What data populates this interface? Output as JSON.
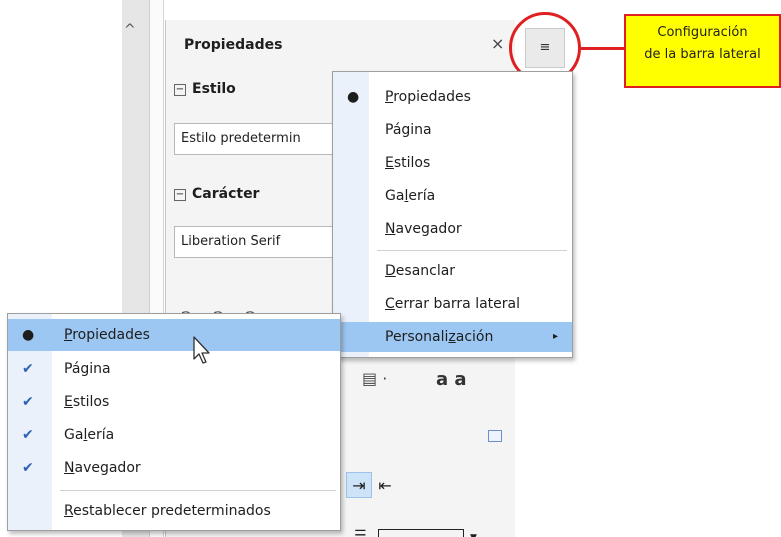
{
  "sidebar": {
    "title": "Propiedades",
    "close_glyph": "×",
    "sections": {
      "estilo": {
        "label": "Estilo",
        "combo_value": "Estilo predetermin"
      },
      "caracter": {
        "label": "Carácter",
        "combo_value": "Liberation Serif"
      }
    },
    "expander_glyph": "−"
  },
  "tab_button": {
    "icon": "sidebar-menu-icon",
    "glyph": "≡"
  },
  "callout": {
    "line1": "Configuración",
    "line2": "de la barra lateral",
    "color": "#ffff00",
    "border": "#e02020"
  },
  "menu_right": {
    "items": [
      {
        "label": "Propiedades",
        "ul": "P",
        "rest": "ropiedades",
        "mark": "●"
      },
      {
        "label": "Página",
        "ul": "",
        "rest": "Página",
        "mark": ""
      },
      {
        "label": "Estilos",
        "ul": "E",
        "rest": "stilos",
        "mark": ""
      },
      {
        "label": "Galería",
        "pre": "Ga",
        "ul": "l",
        "rest": "ería",
        "mark": ""
      },
      {
        "label": "Navegador",
        "ul": "N",
        "rest": "avegador",
        "mark": ""
      }
    ],
    "actions": [
      {
        "label": "Desanclar",
        "ul": "D",
        "rest": "esanclar"
      },
      {
        "label": "Cerrar barra lateral",
        "ul": "C",
        "rest": "errar barra lateral"
      },
      {
        "label": "Personalización",
        "pre": "Personali",
        "ul": "z",
        "rest": "ación",
        "arrow": "▸"
      }
    ]
  },
  "menu_left": {
    "items": [
      {
        "label": "Propiedades",
        "ul": "P",
        "rest": "ropiedades",
        "mark": "●"
      },
      {
        "label": "Página",
        "ul": "",
        "rest": "Página",
        "mark": "✔"
      },
      {
        "label": "Estilos",
        "ul": "E",
        "rest": "stilos",
        "mark": "✔"
      },
      {
        "label": "Galería",
        "pre": "Ga",
        "ul": "l",
        "rest": "ería",
        "mark": "✔"
      },
      {
        "label": "Navegador",
        "ul": "N",
        "rest": "avegador",
        "mark": "✔"
      }
    ],
    "reset": {
      "label": "Restablecer predeterminados",
      "ul": "R",
      "rest": "establecer predeterminados"
    }
  },
  "colors": {
    "highlight": "#9cc7f3",
    "gutter": "#eaf1fb",
    "check": "#2d62b5"
  }
}
